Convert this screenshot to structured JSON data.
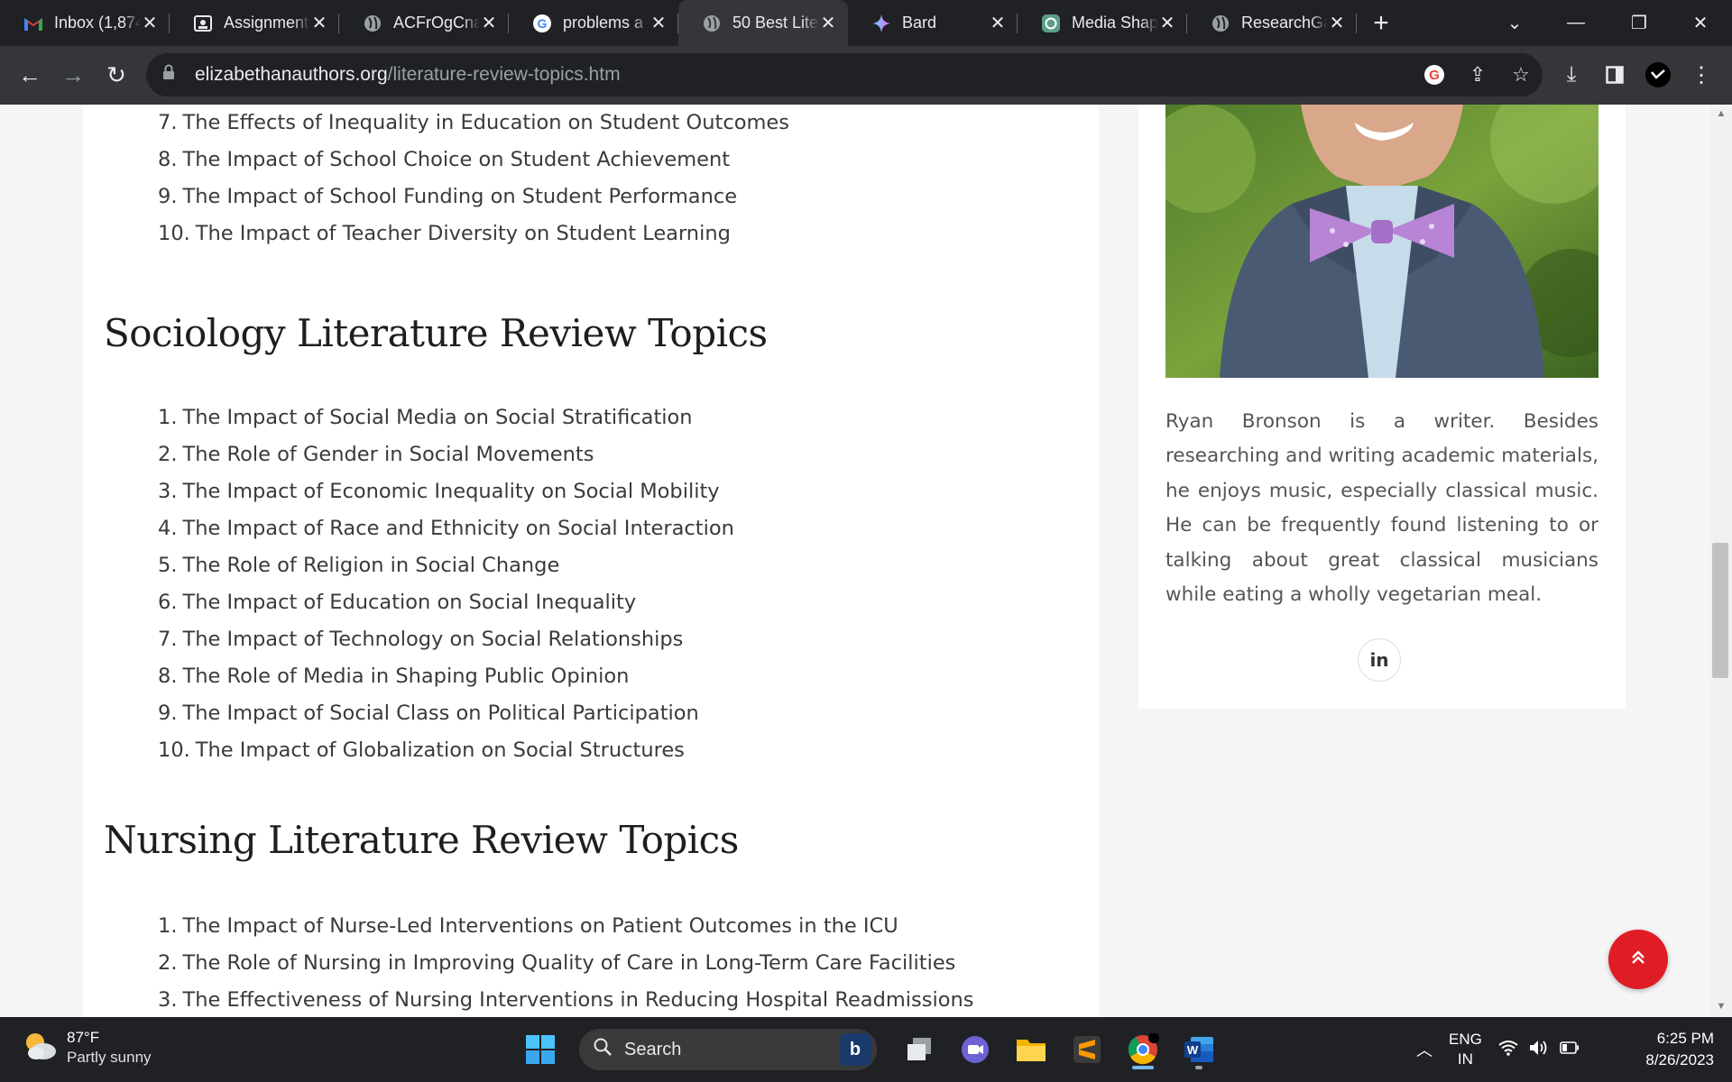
{
  "browser": {
    "tabs": [
      {
        "title": "Inbox (1,874",
        "icon": "gmail-icon"
      },
      {
        "title": "Assignment",
        "icon": "classroom-icon"
      },
      {
        "title": "ACFrOgCna",
        "icon": "globe-icon"
      },
      {
        "title": "problems a",
        "icon": "google-icon"
      },
      {
        "title": "50 Best Lite",
        "icon": "globe-icon",
        "active": true
      },
      {
        "title": "Bard",
        "icon": "bard-icon"
      },
      {
        "title": "Media Shap",
        "icon": "chatgpt-icon"
      },
      {
        "title": "ResearchGa",
        "icon": "globe-icon"
      }
    ],
    "url_host": "elizabethanauthors.org",
    "url_path": "/literature-review-topics.htm"
  },
  "article": {
    "education_items_tail": [
      {
        "num": "7.",
        "text": "The Effects of Inequality in Education on Student Outcomes"
      },
      {
        "num": "8.",
        "text": "The Impact of School Choice on Student Achievement"
      },
      {
        "num": "9.",
        "text": "The Impact of School Funding on Student Performance"
      },
      {
        "num": "10.",
        "text": "The Impact of Teacher Diversity on Student Learning"
      }
    ],
    "sociology": {
      "heading": "Sociology Literature Review Topics",
      "items": [
        {
          "num": "1.",
          "text": "The Impact of Social Media on Social Stratification"
        },
        {
          "num": "2.",
          "text": "The Role of Gender in Social Movements"
        },
        {
          "num": "3.",
          "text": "The Impact of Economic Inequality on Social Mobility"
        },
        {
          "num": "4.",
          "text": "The Impact of Race and Ethnicity on Social Interaction"
        },
        {
          "num": "5.",
          "text": "The Role of Religion in Social Change"
        },
        {
          "num": "6.",
          "text": "The Impact of Education on Social Inequality"
        },
        {
          "num": "7.",
          "text": "The Impact of Technology on Social Relationships"
        },
        {
          "num": "8.",
          "text": "The Role of Media in Shaping Public Opinion"
        },
        {
          "num": "9.",
          "text": "The Impact of Social Class on Political Participation"
        },
        {
          "num": "10.",
          "text": "The Impact of Globalization on Social Structures"
        }
      ]
    },
    "nursing": {
      "heading": "Nursing Literature Review Topics",
      "items": [
        {
          "num": "1.",
          "text": "The Impact of Nurse-Led Interventions on Patient Outcomes in the ICU"
        },
        {
          "num": "2.",
          "text": "The Role of Nursing in Improving Quality of Care in Long-Term Care Facilities"
        },
        {
          "num": "3.",
          "text": "The Effectiveness of Nursing Interventions in Reducing Hospital Readmissions"
        }
      ]
    }
  },
  "author": {
    "bio": "Ryan Bronson is a writer. Besides researching and writing academic materials, he enjoys music, especially classical music. He can be frequently found listening to or talking about great classical musicians while eating a wholly vegetarian meal.",
    "social_label": "in"
  },
  "taskbar": {
    "weather_temp": "87°F",
    "weather_desc": "Partly sunny",
    "search_placeholder": "Search",
    "lang_line1": "ENG",
    "lang_line2": "IN",
    "time": "6:25 PM",
    "date": "8/26/2023"
  },
  "colors": {
    "accent_red": "#e01c24",
    "chrome_dark": "#202124"
  }
}
